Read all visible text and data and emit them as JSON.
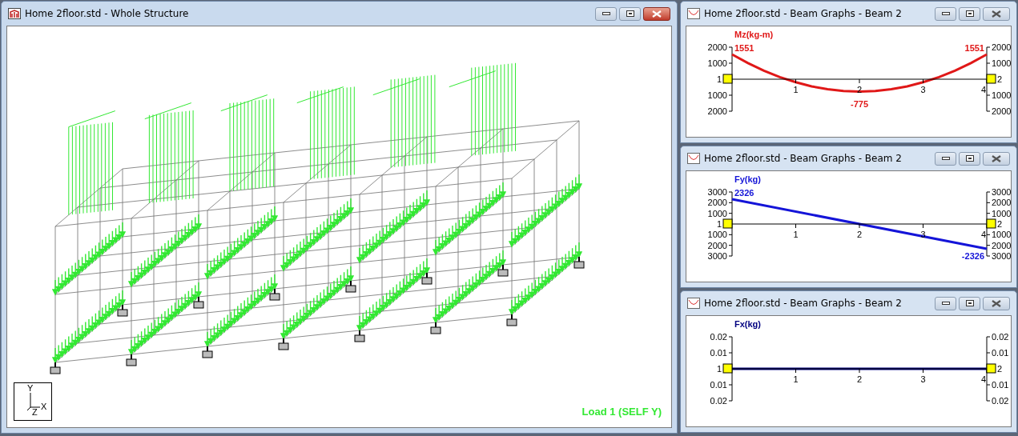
{
  "main_window": {
    "title": "Home 2floor.std - Whole Structure",
    "load_label": "Load 1 (SELF Y)",
    "axes": {
      "y": "Y",
      "x": "X",
      "z": "Z"
    }
  },
  "graph_windows": [
    {
      "title": "Home 2floor.std - Beam Graphs - Beam 2",
      "nodes": [
        "1",
        "2"
      ],
      "chart_data": {
        "type": "line",
        "title": "Mz(kg-m)",
        "x": [
          0,
          0.25,
          0.5,
          0.75,
          1,
          1.25,
          1.5,
          1.75,
          2,
          2.25,
          2.5,
          2.75,
          3,
          3.25,
          3.5,
          3.75,
          4
        ],
        "series": [
          {
            "color": "#e01818",
            "values": [
              1551,
              1010,
              530,
              130,
              -190,
              -450,
              -630,
              -740,
              -775,
              -740,
              -630,
              -450,
              -190,
              130,
              530,
              1010,
              1551
            ]
          }
        ],
        "xlim": [
          0,
          4
        ],
        "ylim": [
          -2000,
          2000
        ],
        "xticks": [
          1,
          2,
          3,
          4
        ],
        "yticks": [
          {
            "value": 2000,
            "label": "2000"
          },
          {
            "value": 1000,
            "label": "1000"
          },
          {
            "value": -1000,
            "label": "1000"
          },
          {
            "value": -2000,
            "label": "2000"
          }
        ],
        "value_labels": [
          "1551",
          null,
          null,
          null,
          null,
          null,
          null,
          null,
          "-775",
          null,
          null,
          null,
          null,
          null,
          null,
          null,
          "1551"
        ]
      }
    },
    {
      "title": "Home 2floor.std - Beam Graphs - Beam 2",
      "nodes": [
        "1",
        "2"
      ],
      "chart_data": {
        "type": "line",
        "title": "Fy(kg)",
        "x": [
          0,
          4
        ],
        "series": [
          {
            "color": "#1414d8",
            "values": [
              2326,
              -2326
            ]
          }
        ],
        "xlim": [
          0,
          4
        ],
        "ylim": [
          -3000,
          3000
        ],
        "xticks": [
          1,
          2,
          3,
          4
        ],
        "yticks": [
          {
            "value": 3000,
            "label": "3000"
          },
          {
            "value": 2000,
            "label": "2000"
          },
          {
            "value": 1000,
            "label": "1000"
          },
          {
            "value": -1000,
            "label": "1000"
          },
          {
            "value": -2000,
            "label": "2000"
          },
          {
            "value": -3000,
            "label": "3000"
          }
        ],
        "value_labels": [
          "2326",
          "-2326"
        ]
      }
    },
    {
      "title": "Home 2floor.std - Beam Graphs - Beam 2",
      "nodes": [
        "1",
        "2"
      ],
      "chart_data": {
        "type": "line",
        "title": "Fx(kg)",
        "x": [
          0,
          4
        ],
        "series": [
          {
            "color": "#000080",
            "values": [
              0,
              0
            ]
          }
        ],
        "xlim": [
          0,
          4
        ],
        "ylim": [
          -0.02,
          0.02
        ],
        "xticks": [
          1,
          2,
          3,
          4
        ],
        "yticks": [
          {
            "value": 0.02,
            "label": "0.02"
          },
          {
            "value": 0.01,
            "label": "0.01"
          },
          {
            "value": -0.01,
            "label": "0.01"
          },
          {
            "value": -0.02,
            "label": "0.02"
          }
        ]
      }
    }
  ]
}
